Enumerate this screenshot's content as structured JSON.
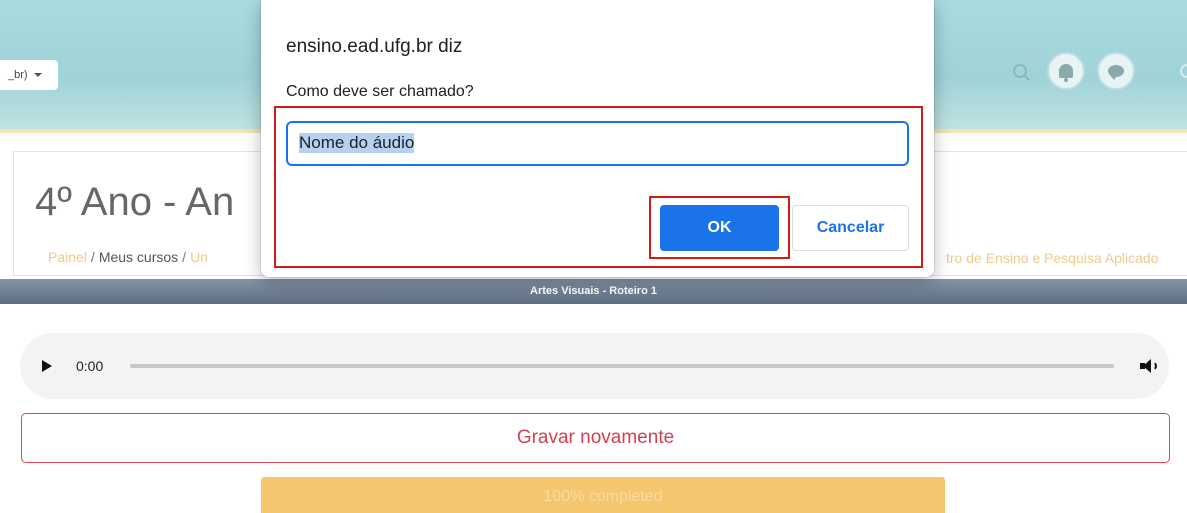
{
  "header": {
    "language_select": "_br)"
  },
  "course": {
    "title": "4º Ano - An",
    "breadcrumb": {
      "painel": "Painel",
      "sep1": "/",
      "meus_cursos": "Meus cursos",
      "sep2": "/",
      "partial": "Un",
      "right_partial": "tro de Ensino e Pesquisa Aplicado"
    }
  },
  "titlebar": {
    "text": "Artes Visuais - Roteiro 1"
  },
  "audio": {
    "time": "0:00",
    "progress": 0
  },
  "record_again_label": "Gravar novamente",
  "completed_label": "100% completed",
  "dialog": {
    "origin": "ensino.ead.ufg.br diz",
    "message": "Como deve ser chamado?",
    "input_value": "Nome do áudio",
    "ok_label": "OK",
    "cancel_label": "Cancelar"
  },
  "colors": {
    "ok_blue": "#1a73e8",
    "annotation_red": "#d11b1b",
    "record_red": "#d43f4f",
    "completed_yellow": "#f4c76f",
    "link_orange": "#f0c98c"
  },
  "icons": [
    "chevron-down-icon",
    "search-icon",
    "bell-icon",
    "chat-icon",
    "play-icon",
    "volume-icon"
  ]
}
